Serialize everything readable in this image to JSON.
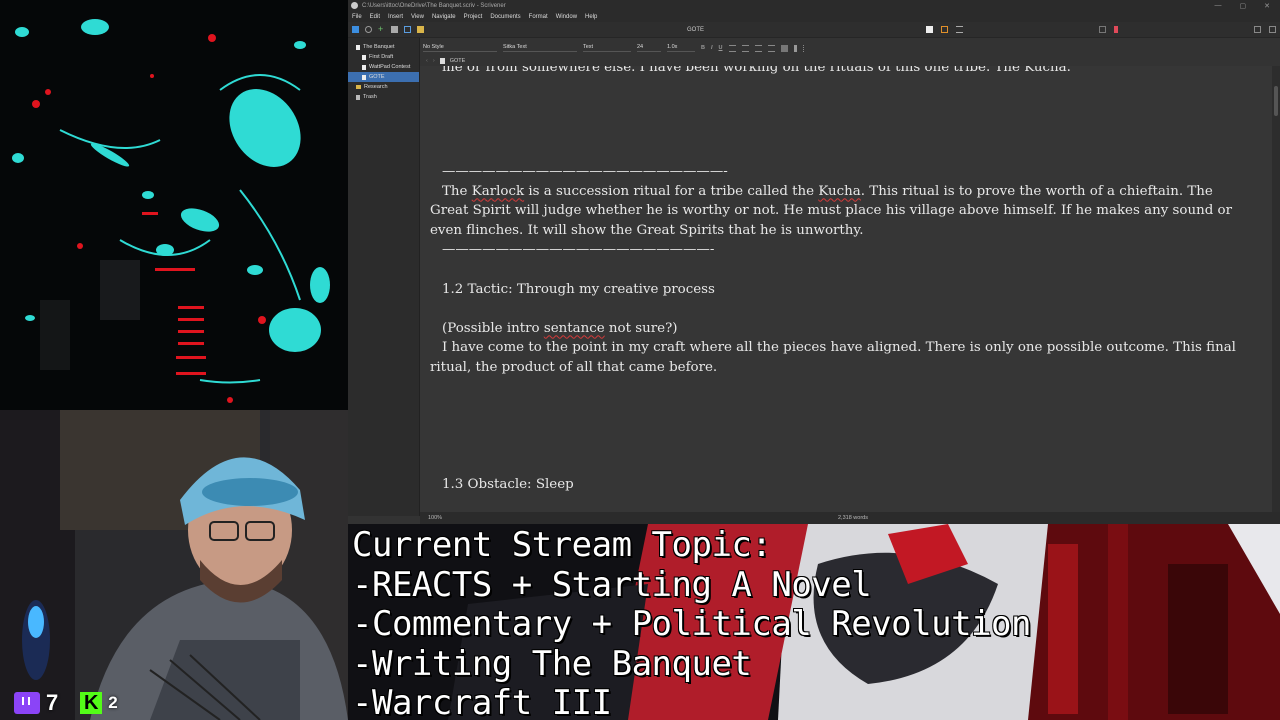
{
  "window": {
    "path_title": "C:\\Users\\ittoc\\OneDrive\\The Banquet.scriv - Scrivener",
    "window_controls": [
      "—",
      "▢",
      "✕"
    ]
  },
  "menu": [
    "File",
    "Edit",
    "Insert",
    "View",
    "Navigate",
    "Project",
    "Documents",
    "Format",
    "Window",
    "Help"
  ],
  "toolbar": {
    "document_title": "GOTE"
  },
  "binder": {
    "items": [
      {
        "label": "The Banquet",
        "icon": "document-icon",
        "level": 0,
        "selected": false
      },
      {
        "label": "First Draft",
        "icon": "document-icon",
        "level": 1,
        "selected": false
      },
      {
        "label": "WattPad Contest",
        "icon": "document-icon",
        "level": 1,
        "selected": false
      },
      {
        "label": "GOTE",
        "icon": "document-icon",
        "level": 1,
        "selected": true
      },
      {
        "label": "Research",
        "icon": "folder-icon",
        "level": 0,
        "selected": false
      },
      {
        "label": "Trash",
        "icon": "trash-icon",
        "level": 0,
        "selected": false
      }
    ]
  },
  "format_bar": {
    "style": "No Style",
    "font": "Sitka Text",
    "typeface": "Text",
    "size": "24",
    "line_spacing": "1.0x",
    "buttons": [
      "B",
      "I",
      "U"
    ]
  },
  "doc_header": {
    "title": "GOTE"
  },
  "editor": {
    "top_line": "me or from somewhere else. I have been working on the rituals of this one tribe. The Kucha.",
    "divider1": "—————————————————————-",
    "p1_a": "The ",
    "p1_karlock": "Karlock",
    "p1_b": " is a succession ritual for a tribe called the ",
    "p1_kucha": "Kucha",
    "p1_c": ". This ritual is to prove the worth of a chieftain. The Great Spirit will judge whether he is worthy or not. He must place his village above himself. If he makes any sound or even flinches. It will show the Great Spirits that he is unworthy.",
    "divider2": "————————————————————-",
    "heading_12": "1.2 Tactic: Through my creative process",
    "intro_a": "(Possible intro ",
    "intro_sentance": "sentance",
    "intro_b": " not sure?)",
    "p2": "I have come to the point in my craft where all the pieces have aligned. There is only one possible outcome. This final ritual, the product of all that came before.",
    "heading_13": "1.3 Obstacle: Sleep"
  },
  "footer": {
    "zoom": "100%",
    "word_count": "2,318 words"
  },
  "stream": {
    "twitch_count": "7",
    "kick_label": "K",
    "kick_count": "2",
    "banner_lines": [
      "Current Stream Topic:",
      "-REACTS + Starting A Novel",
      "-Commentary + Political Revolution",
      "-Writing The Banquet",
      "-Warcraft III"
    ]
  },
  "colors": {
    "editor_bg": "#363636",
    "selection": "#3c6fb0",
    "twitch": "#8b44f7",
    "kick": "#53fc18",
    "art_cyan": "#19e6dc",
    "art_red": "#e0141e"
  }
}
